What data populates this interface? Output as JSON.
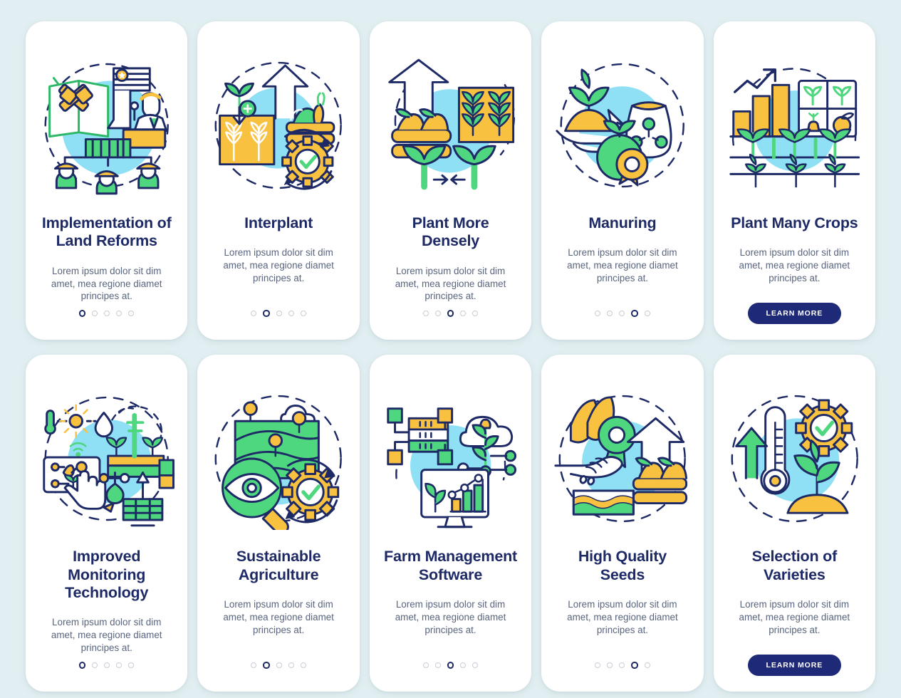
{
  "theme": {
    "page_background": "#e2eff2",
    "card_background": "#ffffff",
    "title_color": "#1e2a66",
    "body_color": "#59657e",
    "accent_navy": "#1e2a78",
    "accent_yellow": "#f8c140",
    "accent_green": "#4fd77f",
    "accent_lightblue": "#8fe0f5",
    "dot_inactive": "#c9ccd6"
  },
  "common": {
    "body_text": "Lorem ipsum dolor sit dim amet, mea regione diamet principes at.",
    "learn_more_label": "LEARN MORE",
    "dot_count": 5
  },
  "rows": [
    {
      "cards": [
        {
          "title": "Implementation of Land Reforms",
          "icon": "land-reform-illustration",
          "body": "Lorem ipsum dolor sit dim amet, mea regione diamet principes at.",
          "active_dot": 0,
          "footer": "dots"
        },
        {
          "title": "Interplant",
          "icon": "interplant-illustration",
          "body": "Lorem ipsum dolor sit dim amet, mea regione diamet principes at.",
          "active_dot": 1,
          "footer": "dots"
        },
        {
          "title": "Plant More Densely",
          "icon": "plant-more-densely-illustration",
          "body": "Lorem ipsum dolor sit dim amet, mea regione diamet principes at.",
          "active_dot": 2,
          "footer": "dots"
        },
        {
          "title": "Manuring",
          "icon": "manuring-illustration",
          "body": "Lorem ipsum dolor sit dim amet, mea regione diamet principes at.",
          "active_dot": 3,
          "footer": "dots"
        },
        {
          "title": "Plant Many Crops",
          "icon": "plant-many-crops-illustration",
          "body": "Lorem ipsum dolor sit dim amet, mea regione diamet principes at.",
          "active_dot": 4,
          "footer": "button",
          "button_label": "LEARN MORE"
        }
      ]
    },
    {
      "cards": [
        {
          "title": "Improved Monitoring Technology",
          "icon": "monitoring-technology-illustration",
          "body": "Lorem ipsum dolor sit dim amet, mea regione diamet principes at.",
          "active_dot": 0,
          "footer": "dots"
        },
        {
          "title": "Sustainable Agriculture",
          "icon": "sustainable-agriculture-illustration",
          "body": "Lorem ipsum dolor sit dim amet, mea regione diamet principes at.",
          "active_dot": 1,
          "footer": "dots"
        },
        {
          "title": "Farm Management Software",
          "icon": "farm-management-software-illustration",
          "body": "Lorem ipsum dolor sit dim amet, mea regione diamet principes at.",
          "active_dot": 2,
          "footer": "dots"
        },
        {
          "title": "High Quality Seeds",
          "icon": "high-quality-seeds-illustration",
          "body": "Lorem ipsum dolor sit dim amet, mea regione diamet principes at.",
          "active_dot": 3,
          "footer": "dots"
        },
        {
          "title": "Selection of Varieties",
          "icon": "selection-of-varieties-illustration",
          "body": "Lorem ipsum dolor sit dim amet, mea regione diamet principes at.",
          "active_dot": 4,
          "footer": "button",
          "button_label": "LEARN MORE"
        }
      ]
    }
  ]
}
